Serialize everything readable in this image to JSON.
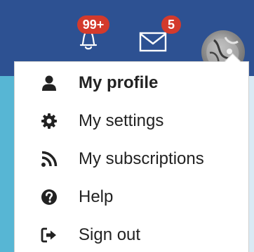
{
  "header": {
    "notifications": {
      "icon": "bell-icon",
      "badge": "99+"
    },
    "messages": {
      "icon": "envelope-icon",
      "badge": "5"
    },
    "avatar": {
      "icon": "user-avatar"
    }
  },
  "menu": {
    "items": [
      {
        "label": "My profile",
        "icon": "user-icon",
        "bold": true
      },
      {
        "label": "My settings",
        "icon": "gear-icon"
      },
      {
        "label": "My subscriptions",
        "icon": "rss-icon"
      },
      {
        "label": "Help",
        "icon": "question-circle-icon"
      },
      {
        "label": "Sign out",
        "icon": "sign-out-icon"
      }
    ]
  },
  "colors": {
    "header_bg": "#2d5192",
    "badge_bg": "#d33a2c",
    "left_strip": "#57b6d4",
    "text": "#222222"
  }
}
